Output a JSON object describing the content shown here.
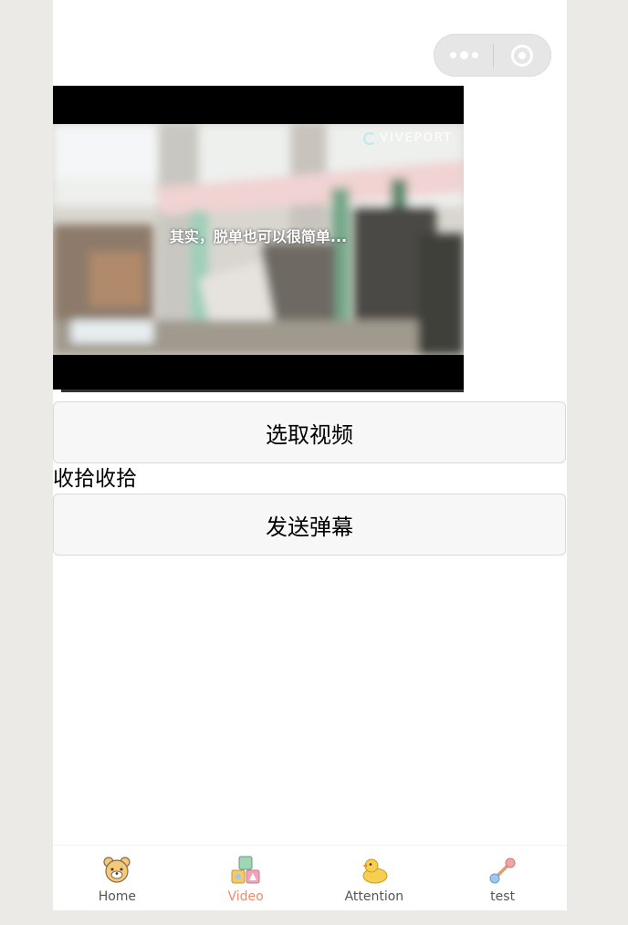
{
  "capsule": {
    "more_icon": "more-dots-icon",
    "close_icon": "close-circle-icon"
  },
  "video": {
    "watermark": "VIVEPORT",
    "subtitle": "其实，脱单也可以很简单...",
    "progress": 0.02
  },
  "buttons": {
    "choose_video": "选取视频",
    "send_danmu": "发送弹幕"
  },
  "text_line": "收拾收拾",
  "tabbar": {
    "active_color": "#f08a6a",
    "items": [
      {
        "label": "Home",
        "icon": "bear-icon"
      },
      {
        "label": "Video",
        "icon": "blocks-icon"
      },
      {
        "label": "Attention",
        "icon": "duck-icon"
      },
      {
        "label": "test",
        "icon": "rattle-icon"
      }
    ]
  }
}
